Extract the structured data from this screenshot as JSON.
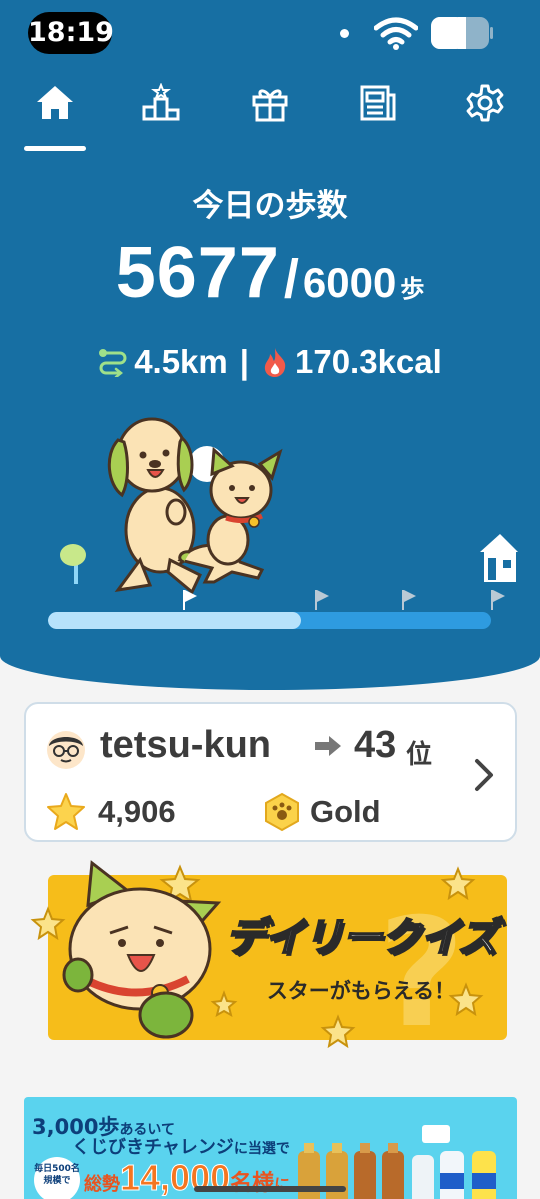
{
  "status_bar": {
    "time": "18:19"
  },
  "nav": {
    "items": [
      {
        "name": "home",
        "icon": "home-icon",
        "active": true
      },
      {
        "name": "ranking",
        "icon": "podium-icon",
        "active": false
      },
      {
        "name": "gift",
        "icon": "gift-icon",
        "active": false
      },
      {
        "name": "news",
        "icon": "newspaper-icon",
        "active": false
      },
      {
        "name": "settings",
        "icon": "gear-icon",
        "active": false
      }
    ]
  },
  "steps": {
    "title": "今日の歩数",
    "current": "5677",
    "slash": "/",
    "goal": "6000",
    "unit": "歩",
    "progress": 0.57
  },
  "metrics": {
    "distance": "4.5km",
    "separator": "|",
    "calories": "170.3kcal"
  },
  "ranking_card": {
    "username": "tetsu-kun",
    "rank": "43",
    "rank_unit": "位",
    "stars": "4,906",
    "tier": "Gold"
  },
  "quiz_banner": {
    "title": "デイリークイズ",
    "subtitle": "スターがもらえる！"
  },
  "ad_banner": {
    "line1_a": "3,000歩",
    "line1_b": "あるいて",
    "line2_a": "くじびきチャレンジ",
    "line2_b": "に当選で",
    "circle_text": "毎日500名規模で",
    "line3_a": "総勢",
    "line3_b": "14,000",
    "line3_c": "名様",
    "line3_d": "に"
  },
  "colors": {
    "hero_bg": "#176fa3",
    "progress_fill": "#b7e2fb",
    "progress_track": "#2e9be0",
    "quiz_bg": "#f6bd1a",
    "ad_bg": "#5ad3ee"
  }
}
